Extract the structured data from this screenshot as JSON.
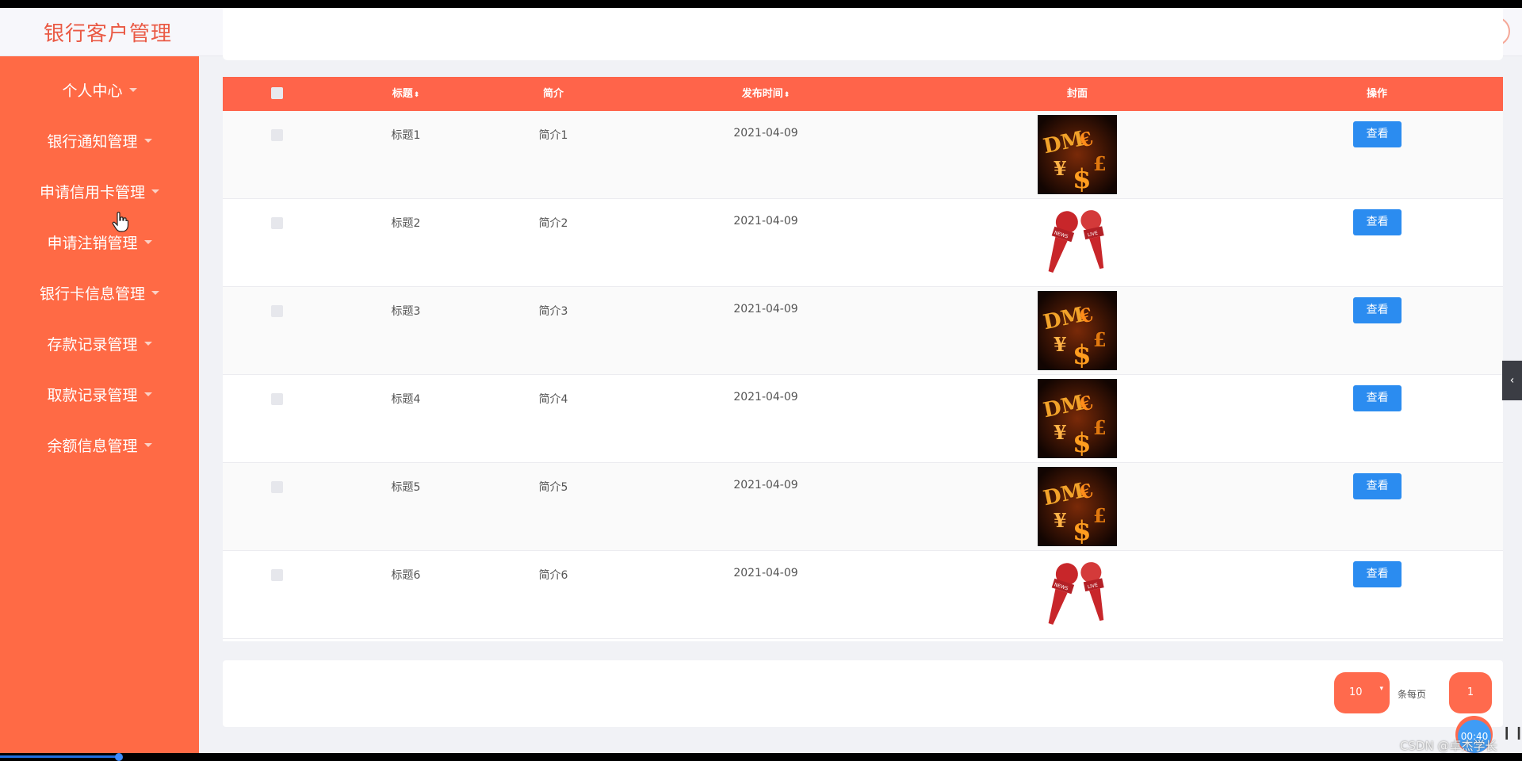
{
  "header": {
    "title": "银行客户管理",
    "fullscreen_icon": "expand-arrows-icon",
    "user_icon": "user-icon"
  },
  "sidebar": {
    "items": [
      {
        "label": "个人中心"
      },
      {
        "label": "银行通知管理"
      },
      {
        "label": "申请信用卡管理"
      },
      {
        "label": "申请注销管理"
      },
      {
        "label": "银行卡信息管理"
      },
      {
        "label": "存款记录管理"
      },
      {
        "label": "取款记录管理"
      },
      {
        "label": "余额信息管理"
      }
    ]
  },
  "table": {
    "columns": {
      "title": "标题",
      "intro": "简介",
      "published": "发布时间",
      "cover": "封面",
      "actions": "操作"
    },
    "sort_glyph": "⬍",
    "rows": [
      {
        "title": "标题1",
        "intro": "简介1",
        "date": "2021-04-09",
        "cover": "money-symbols",
        "action": "查看"
      },
      {
        "title": "标题2",
        "intro": "简介2",
        "date": "2021-04-09",
        "cover": "news-microphones",
        "action": "查看"
      },
      {
        "title": "标题3",
        "intro": "简介3",
        "date": "2021-04-09",
        "cover": "money-symbols",
        "action": "查看"
      },
      {
        "title": "标题4",
        "intro": "简介4",
        "date": "2021-04-09",
        "cover": "money-symbols",
        "action": "查看"
      },
      {
        "title": "标题5",
        "intro": "简介5",
        "date": "2021-04-09",
        "cover": "money-symbols",
        "action": "查看"
      },
      {
        "title": "标题6",
        "intro": "简介6",
        "date": "2021-04-09",
        "cover": "news-microphones",
        "action": "查看"
      }
    ]
  },
  "pagination": {
    "page_size": "10",
    "per_page_label": "条每页",
    "current_page": "1"
  },
  "overlay": {
    "timer": "00:40",
    "pause": "❙❙",
    "watermark": "CSDN @卓杰学长",
    "side_tab": "‹"
  },
  "colors": {
    "brand": "#ff6a45",
    "table_header": "#ff644a",
    "primary_button": "#2b8cf0"
  }
}
